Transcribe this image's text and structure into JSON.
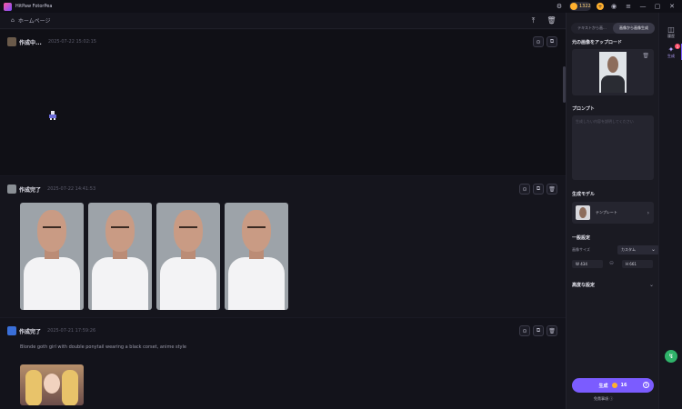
{
  "app": {
    "title": "HitPaw FotorPea",
    "coins": "1322"
  },
  "nav": {
    "home": "ホームページ"
  },
  "feed": [
    {
      "status": "作成中...",
      "date": "2025-07-22  15:02:15"
    },
    {
      "status": "作成完了",
      "date": "2025-07-22  14:41:53"
    },
    {
      "status": "作成完了",
      "date": "2025-07-21  17:59:26",
      "prompt": "Blonde goth girl with double ponytail wearing a black corset, anime style"
    }
  ],
  "panel": {
    "tabs": [
      "テキストから画...",
      "画像から画像生成"
    ],
    "upload_label": "元の画像をアップロード",
    "prompt_label": "プロンプト",
    "prompt_placeholder": "生成したい内容を説明してください",
    "model_label": "生成モデル",
    "model_name": "テンプレート",
    "general_label": "一般設定",
    "size_label": "画像サイズ",
    "size_value": "カスタム",
    "width": "W 434",
    "height": "H 661",
    "advanced_label": "高度な設定",
    "generate_label": "生成",
    "generate_cost": "16",
    "disclaimer": "免責事項"
  },
  "rail": {
    "history": "履歴",
    "generate": "生成",
    "badge": "1"
  },
  "colors": {
    "accent": "#7b5cff",
    "coin": "#ffb02e",
    "bg": "#121219",
    "panel": "#1a1a22"
  },
  "icons": [
    "logo-icon",
    "settings-icon",
    "coin-icon",
    "plus-icon",
    "user-icon",
    "menu-icon",
    "minimize-icon",
    "maximize-icon",
    "close-icon",
    "home-icon",
    "upload-top-icon",
    "trash-icon",
    "download-icon",
    "copy-icon",
    "chevron-right-icon",
    "chevron-down-icon",
    "lock-icon",
    "info-icon",
    "history-icon",
    "sparkle-icon"
  ]
}
